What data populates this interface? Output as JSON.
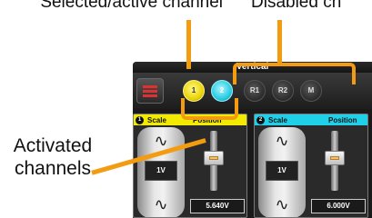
{
  "callouts": {
    "top_left": "Selected/active channel",
    "top_right": "Disabled ch",
    "bottom": "Activated channels"
  },
  "window": {
    "title": "Vertical"
  },
  "menu_button": {
    "icon": "hamburger-menu-icon",
    "color": "#e03030"
  },
  "channels": [
    {
      "label": "1",
      "state": "selected",
      "color": "#f2ea00"
    },
    {
      "label": "2",
      "state": "active",
      "color": "#1fd0e8"
    },
    {
      "label": "R1",
      "state": "disabled"
    },
    {
      "label": "R2",
      "state": "disabled"
    },
    {
      "label": "M",
      "state": "disabled"
    }
  ],
  "panels": [
    {
      "number": "1",
      "scale_label": "Scale",
      "position_label": "Position",
      "scale_value": "1V",
      "position_value": "5.640V",
      "color": "#f2ea00"
    },
    {
      "number": "2",
      "scale_label": "Scale",
      "position_label": "Position",
      "scale_value": "1V",
      "position_value": "6.000V",
      "color": "#1fd0e8"
    }
  ],
  "knob_icons": {
    "top": "small-waveform-icon",
    "bottom": "large-waveform-icon"
  },
  "annotation_color": "#f39c12"
}
